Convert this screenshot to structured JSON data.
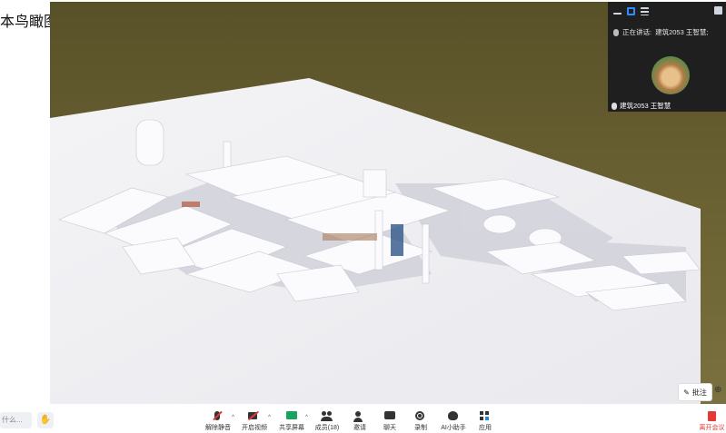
{
  "slide": {
    "title": "本鸟瞰图"
  },
  "video_panel": {
    "speaking_label": "正在讲话:",
    "speaking_name": "建筑2053 王智慧;",
    "participant_name": "建筑2053 王智慧"
  },
  "floating": {
    "annotate_label": "批注"
  },
  "chat": {
    "input_placeholder": "什么..."
  },
  "toolbar": {
    "items": [
      {
        "label": "解除静音",
        "icon": "mic-muted-icon"
      },
      {
        "label": "开启视频",
        "icon": "camera-off-icon"
      },
      {
        "label": "共享屏幕",
        "icon": "share-screen-icon"
      },
      {
        "label": "成员(18)",
        "icon": "members-icon"
      },
      {
        "label": "邀请",
        "icon": "invite-icon"
      },
      {
        "label": "聊天",
        "icon": "chat-icon"
      },
      {
        "label": "录制",
        "icon": "record-icon"
      },
      {
        "label": "AI小助手",
        "icon": "ai-assistant-icon"
      },
      {
        "label": "应用",
        "icon": "apps-icon"
      }
    ],
    "leave_label": "离开会议"
  },
  "colors": {
    "accent": "#2d8cff",
    "danger": "#e53935",
    "share": "#1aa260",
    "panel_bg": "#1f1f1f"
  }
}
